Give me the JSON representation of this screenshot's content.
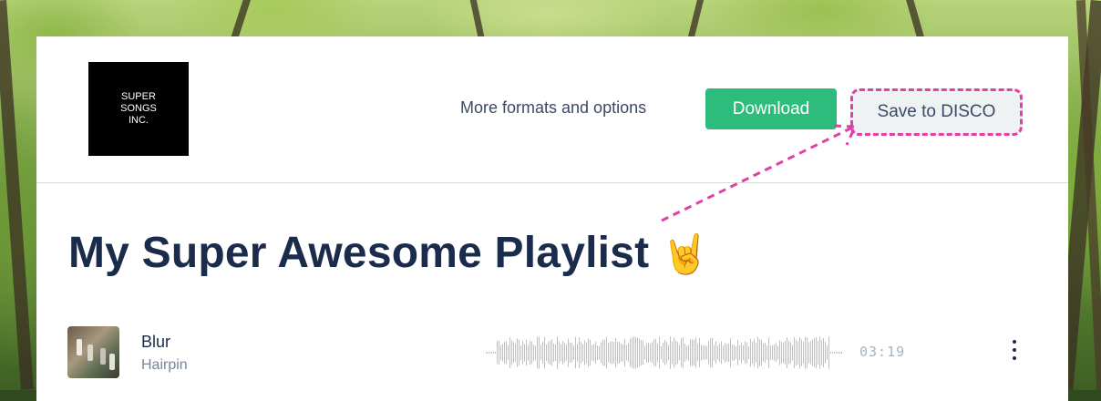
{
  "brand": {
    "logo_text": "SUPER\nSONGS\nINC.",
    "logo_icon": "company-logo"
  },
  "header": {
    "more_link": "More formats and options",
    "download_label": "Download",
    "save_label": "Save to DISCO"
  },
  "playlist": {
    "title": "My Super Awesome Playlist",
    "title_emoji": "🤘"
  },
  "tracks": [
    {
      "name": "Blur",
      "artist": "Hairpin",
      "duration": "03:19",
      "menu_icon": "more-vertical-icon"
    }
  ],
  "colors": {
    "accent_green": "#2ebc7d",
    "annotation_pink": "#e040a8",
    "title_navy": "#1a2b4c"
  }
}
